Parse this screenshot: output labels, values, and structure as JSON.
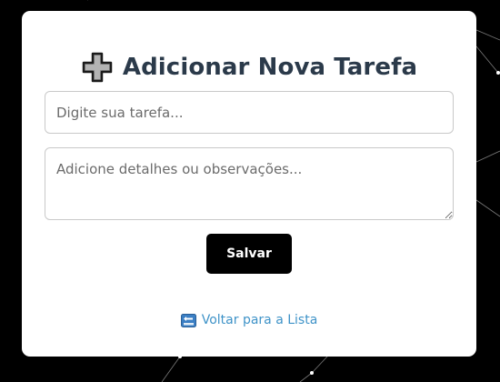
{
  "card": {
    "title_icon": "heavy-plus-icon",
    "title": "Adicionar Nova Tarefa"
  },
  "form": {
    "task_placeholder": "Digite sua tarefa...",
    "task_value": "",
    "details_placeholder": "Adicione detalhes ou observações...",
    "details_value": "",
    "save_label": "Salvar"
  },
  "footer": {
    "back_icon": "back-arrow-icon",
    "back_label": "Voltar para a Lista"
  },
  "colors": {
    "background": "#000000",
    "card": "#ffffff",
    "title": "#2b3a4a",
    "button": "#000000",
    "link": "#3f93c8"
  }
}
